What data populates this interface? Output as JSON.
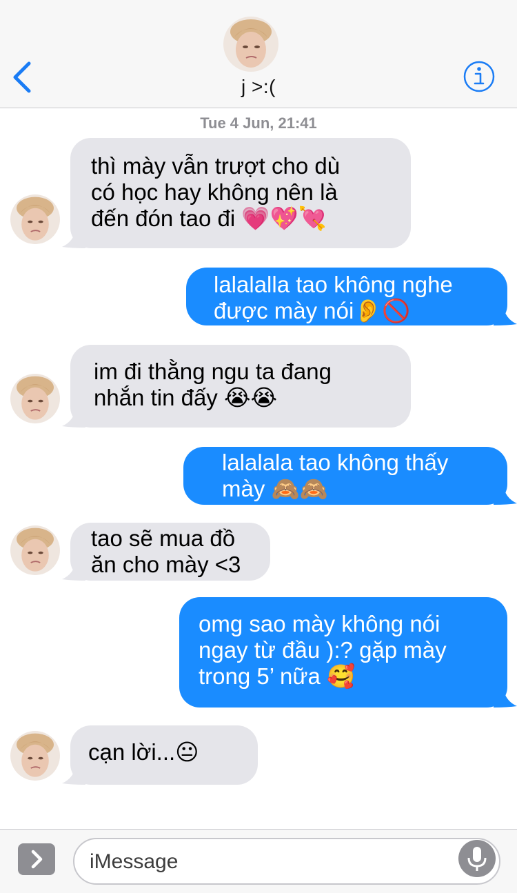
{
  "header": {
    "contact_name": "j >:("
  },
  "timestamp": "Tue 4 Jun, 21:41",
  "messages": [
    {
      "direction": "in",
      "text": "thì mày vẫn trượt cho dù\ncó học hay không nên là\nđến đón tao đi 💗💖💘"
    },
    {
      "direction": "out",
      "text": "lalalalla tao không nghe\n được mày nói👂🚫"
    },
    {
      "direction": "in",
      "text": "im đi thằng ngu ta đang\nnhắn tin đấy 😭😭"
    },
    {
      "direction": "out",
      "text": "lalalala tao không thấy\nmày 🙈🙈"
    },
    {
      "direction": "in",
      "text": "tao sẽ mua đồ\năn cho mày <3"
    },
    {
      "direction": "out",
      "text": "omg sao mày không nói\nngay từ đầu ):? gặp mày\ntrong 5’ nữa 🥰"
    },
    {
      "direction": "in",
      "text": "cạn lời...😐"
    }
  ],
  "input": {
    "placeholder": "iMessage"
  },
  "icons": {
    "back": "chevron-left-icon",
    "info": "info-icon",
    "apps": "chevron-right-icon",
    "mic": "microphone-icon"
  },
  "colors": {
    "accent": "#1a8cff",
    "incoming_bubble": "#e5e5ea",
    "outgoing_bubble": "#1a8cff",
    "header_bg": "#f7f7f7",
    "timestamp": "#8e8e93"
  }
}
